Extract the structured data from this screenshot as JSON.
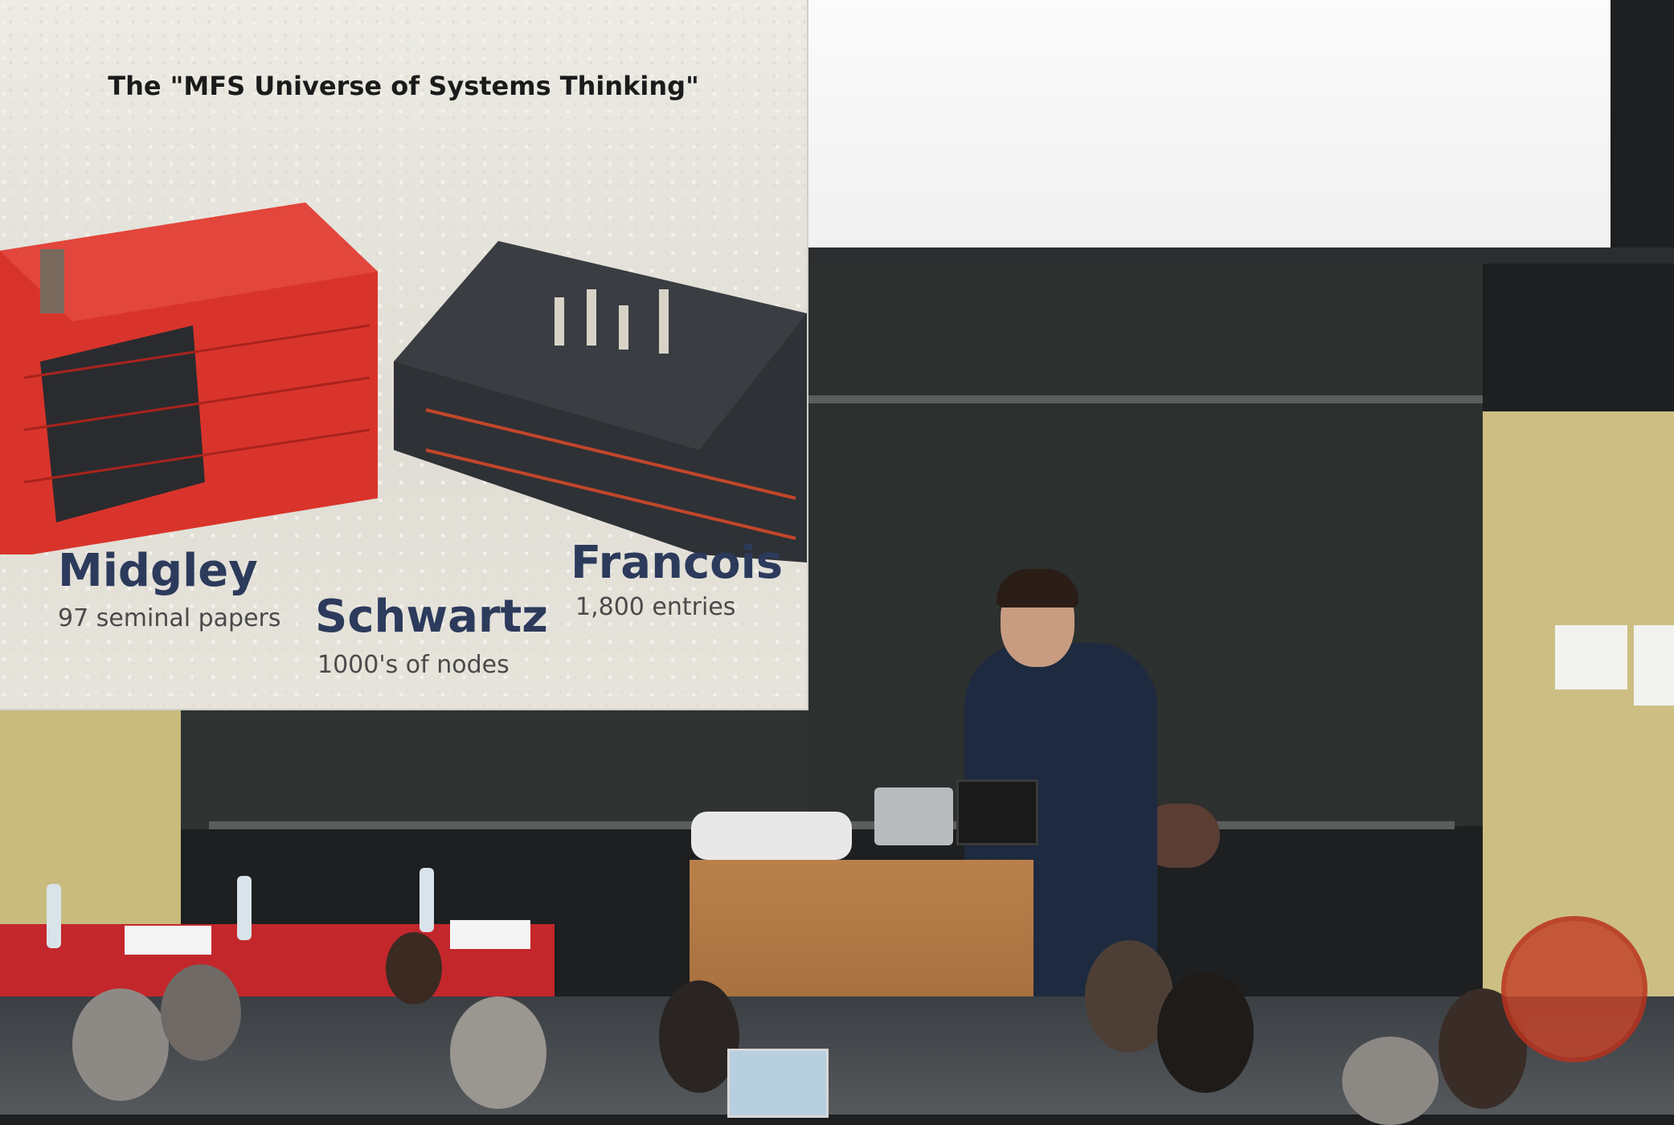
{
  "slide": {
    "title": "The \"MFS Universe of Systems Thinking\"",
    "authors": [
      {
        "name": "Midgley",
        "detail": "97 seminal papers"
      },
      {
        "name": "Schwartz",
        "detail": "1000's of nodes"
      },
      {
        "name": "Francois",
        "detail": "1,800 entries"
      }
    ]
  },
  "colors": {
    "book_red": "#d9342b",
    "book_dark": "#2e3135",
    "author_blue": "#2c3a5c",
    "table_red": "#c3272b",
    "wall_yellow": "#cdbf83"
  }
}
